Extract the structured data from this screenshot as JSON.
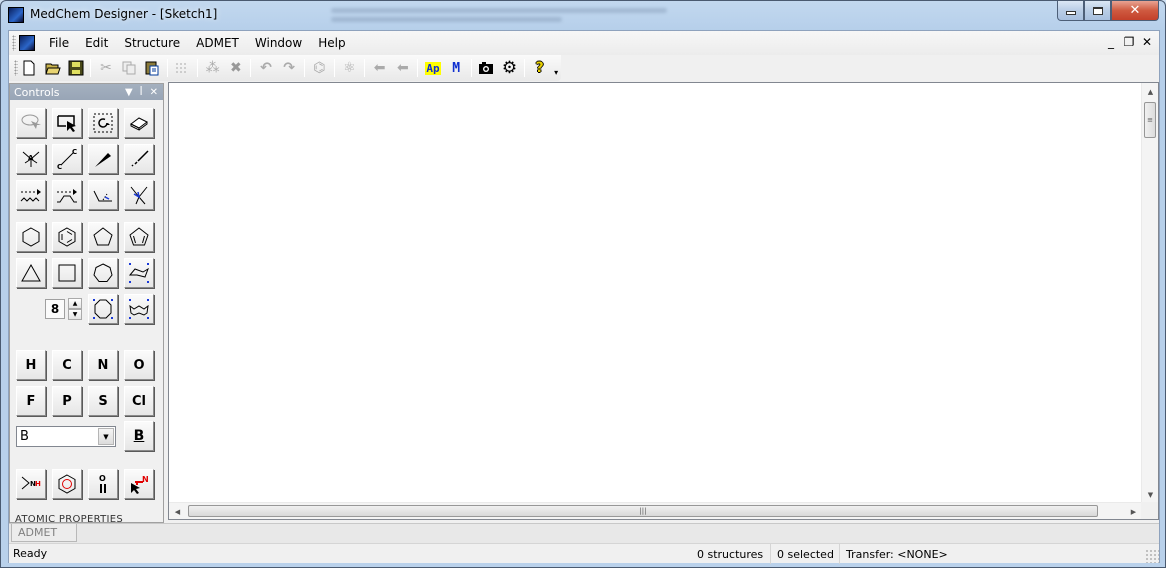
{
  "window": {
    "title": "MedChem Designer - [Sketch1]",
    "caption_buttons": {
      "minimize": "minimize",
      "maximize": "maximize",
      "close": "✕"
    }
  },
  "menubar": {
    "items": [
      {
        "label": "File"
      },
      {
        "label": "Edit"
      },
      {
        "label": "Structure"
      },
      {
        "label": "ADMET"
      },
      {
        "label": "Window"
      },
      {
        "label": "Help"
      }
    ],
    "mdi_buttons": {
      "minimize": "_",
      "restore": "❐",
      "close": "✕"
    }
  },
  "toolbar": {
    "buttons": [
      {
        "name": "new",
        "glyph": "🗋",
        "enabled": true
      },
      {
        "name": "open",
        "glyph": "📂",
        "enabled": true
      },
      {
        "name": "save",
        "glyph": "💾",
        "enabled": true
      },
      {
        "name": "cut",
        "glyph": "✂",
        "enabled": false
      },
      {
        "name": "copy",
        "glyph": "⎘",
        "enabled": false
      },
      {
        "name": "paste",
        "glyph": "📋",
        "enabled": true
      },
      {
        "name": "select-all",
        "glyph": "⋮",
        "enabled": false
      },
      {
        "name": "clear",
        "glyph": "⁂",
        "enabled": false
      },
      {
        "name": "delete",
        "glyph": "✖",
        "enabled": false
      },
      {
        "name": "undo",
        "glyph": "↶",
        "enabled": false
      },
      {
        "name": "redo",
        "glyph": "↷",
        "enabled": false
      },
      {
        "name": "clean-structure",
        "glyph": "⌬",
        "enabled": false
      },
      {
        "name": "convert",
        "glyph": "⚛",
        "enabled": false
      },
      {
        "name": "back",
        "glyph": "⬅",
        "enabled": false
      },
      {
        "name": "back-delete",
        "glyph": "⬅",
        "enabled": false
      },
      {
        "name": "admet-predictor",
        "glyph": "Ap",
        "enabled": true
      },
      {
        "name": "mol-properties",
        "glyph": "M",
        "enabled": true
      },
      {
        "name": "snapshot",
        "glyph": "📷",
        "enabled": true
      },
      {
        "name": "settings",
        "glyph": "⚙",
        "enabled": true
      },
      {
        "name": "help",
        "glyph": "?",
        "enabled": true
      }
    ]
  },
  "controls": {
    "title": "Controls",
    "header_buttons": {
      "dropdown": "▼",
      "pin": "ꟾ",
      "close": "✕"
    },
    "ring_size": "8",
    "atoms": [
      "H",
      "C",
      "N",
      "O",
      "F",
      "P",
      "S",
      "Cl"
    ],
    "element_select": {
      "value": "B"
    },
    "element_button": "B",
    "section_label": "ATOMIC PROPERTIES"
  },
  "tabs": [
    {
      "label": "ADMET"
    }
  ],
  "status": {
    "ready": "Ready",
    "structures": "0 structures",
    "selected": "0 selected",
    "transfer": "Transfer: <NONE>"
  },
  "scroll": {
    "up": "▲",
    "down": "▼",
    "left": "◀",
    "right": "▶",
    "grip": "≡"
  }
}
